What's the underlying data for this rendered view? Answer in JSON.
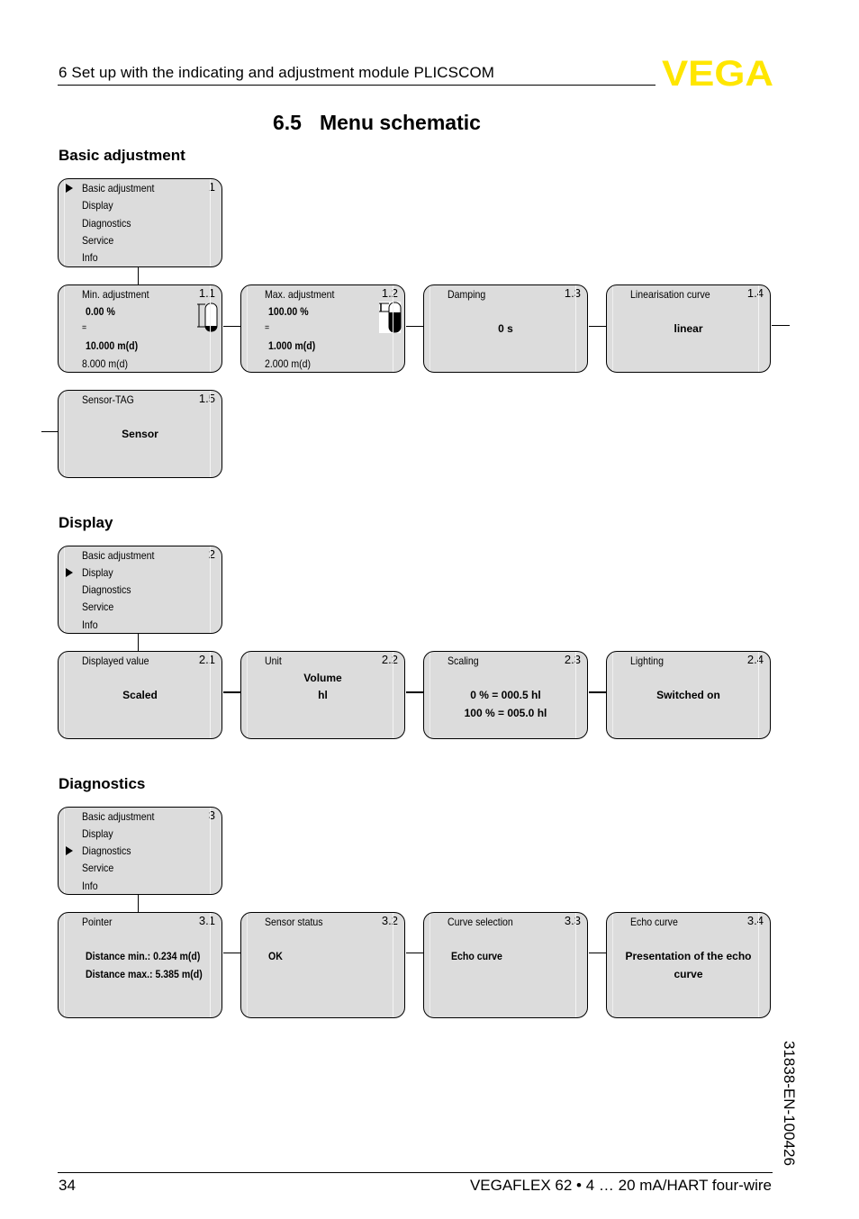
{
  "header": {
    "chapter": "6   Set up with the indicating and adjustment module PLICSCOM",
    "logo_text": "VEGA",
    "logo_color": "#ffe600"
  },
  "section": {
    "number": "6.5",
    "title": "Menu schematic"
  },
  "groups": {
    "basic": {
      "heading": "Basic adjustment",
      "main_menu": {
        "number": "1",
        "items": [
          "Basic adjustment",
          "Display",
          "Diagnostics",
          "Service",
          "Info"
        ],
        "selected_index": 0
      },
      "min_adj": {
        "title": "Min. adjustment",
        "number": "1.1",
        "percent": "0.00 %",
        "equals": "=",
        "distance": "10.000 m(d)",
        "current": "8.000 m(d)",
        "icon": "tank-empty-icon"
      },
      "max_adj": {
        "title": "Max. adjustment",
        "number": "1.2",
        "percent": "100.00 %",
        "equals": "=",
        "distance": "1.000 m(d)",
        "current": "2.000 m(d)",
        "icon": "tank-full-icon"
      },
      "damping": {
        "title": "Damping",
        "number": "1.3",
        "value": "0 s"
      },
      "lin_curve": {
        "title": "Linearisation curve",
        "number": "1.4",
        "value": "linear"
      },
      "sensor_tag": {
        "title": "Sensor-TAG",
        "number": "1.5",
        "value": "Sensor"
      }
    },
    "display": {
      "heading": "Display",
      "main_menu": {
        "number": "2",
        "items": [
          "Basic adjustment",
          "Display",
          "Diagnostics",
          "Service",
          "Info"
        ],
        "selected_index": 1
      },
      "displayed_value": {
        "title": "Displayed value",
        "number": "2.1",
        "value": "Scaled"
      },
      "unit": {
        "title": "Unit",
        "number": "2.2",
        "line1": "Volume",
        "line2": "hl"
      },
      "scaling": {
        "title": "Scaling",
        "number": "2.3",
        "line1": "0 % = 000.5 hl",
        "line2": "100 % = 005.0 hl"
      },
      "lighting": {
        "title": "Lighting",
        "number": "2.4",
        "value": "Switched on"
      }
    },
    "diagnostics": {
      "heading": "Diagnostics",
      "main_menu": {
        "number": "3",
        "items": [
          "Basic adjustment",
          "Display",
          "Diagnostics",
          "Service",
          "Info"
        ],
        "selected_index": 2
      },
      "pointer": {
        "title": "Pointer",
        "number": "3.1",
        "line1": "Distance min.: 0.234 m(d)",
        "line2": "Distance max.: 5.385 m(d)"
      },
      "sensor_status": {
        "title": "Sensor status",
        "number": "3.2",
        "value": "OK"
      },
      "curve_selection": {
        "title": "Curve selection",
        "number": "3.3",
        "value": "Echo curve"
      },
      "echo_curve": {
        "title": "Echo curve",
        "number": "3.4",
        "line1": "Presentation of the echo",
        "line2": "curve"
      }
    }
  },
  "footer": {
    "page": "34",
    "product": "VEGAFLEX 62 • 4 … 20 mA/HART four-wire",
    "doc_id": "31838-EN-100426"
  }
}
